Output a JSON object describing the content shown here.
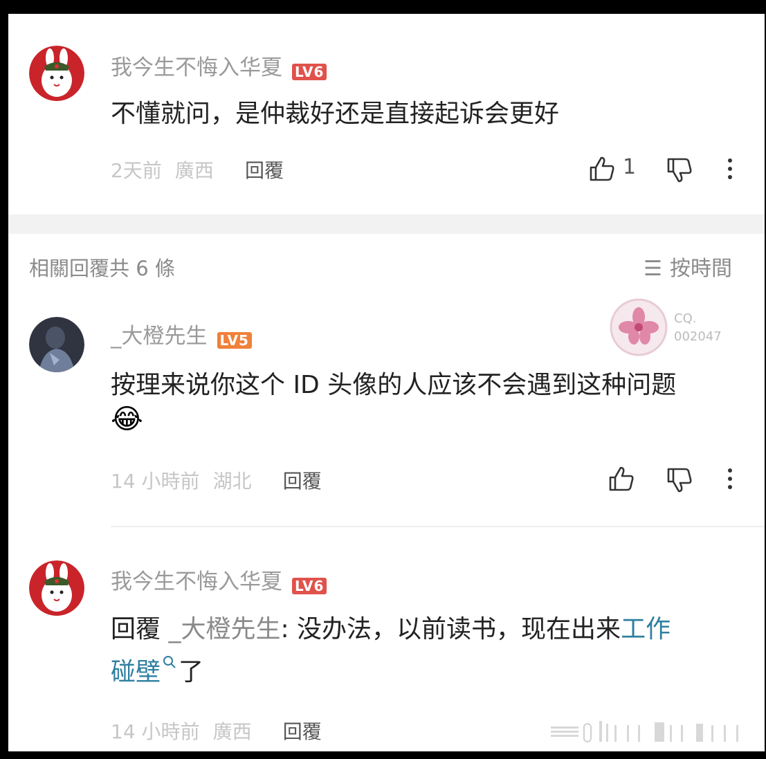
{
  "comment_top": {
    "username": "我今生不悔入华夏",
    "level": "LV6",
    "text": "不懂就问，是仲裁好还是直接起诉会更好",
    "time": "2天前",
    "location": "廣西",
    "reply_label": "回覆",
    "like_count": "1"
  },
  "replies_header": {
    "title": "相關回覆共 6 條",
    "sort_label": "按時間"
  },
  "reply_1": {
    "username": "_大橙先生",
    "level": "LV5",
    "text": "按理来说你这个 ID 头像的人应该不会遇到这种问题",
    "emoji": "😂",
    "time": "14 小時前",
    "location": "湖北",
    "reply_label": "回覆",
    "badge_line1": "CQ.",
    "badge_line2": "002047"
  },
  "reply_2": {
    "username": "我今生不悔入华夏",
    "level": "LV6",
    "prefix": "回覆",
    "mention": "_大橙先生",
    "text_part1": ": 没办法，以前读书，现在出来",
    "link_part1": "工作",
    "link_part2": "碰壁",
    "text_part2": "了",
    "time": "14 小時前",
    "location": "廣西",
    "reply_label": "回覆"
  },
  "colors": {
    "level6": "#e0524c",
    "level5": "#f0803a",
    "link": "#2e7fa0"
  }
}
